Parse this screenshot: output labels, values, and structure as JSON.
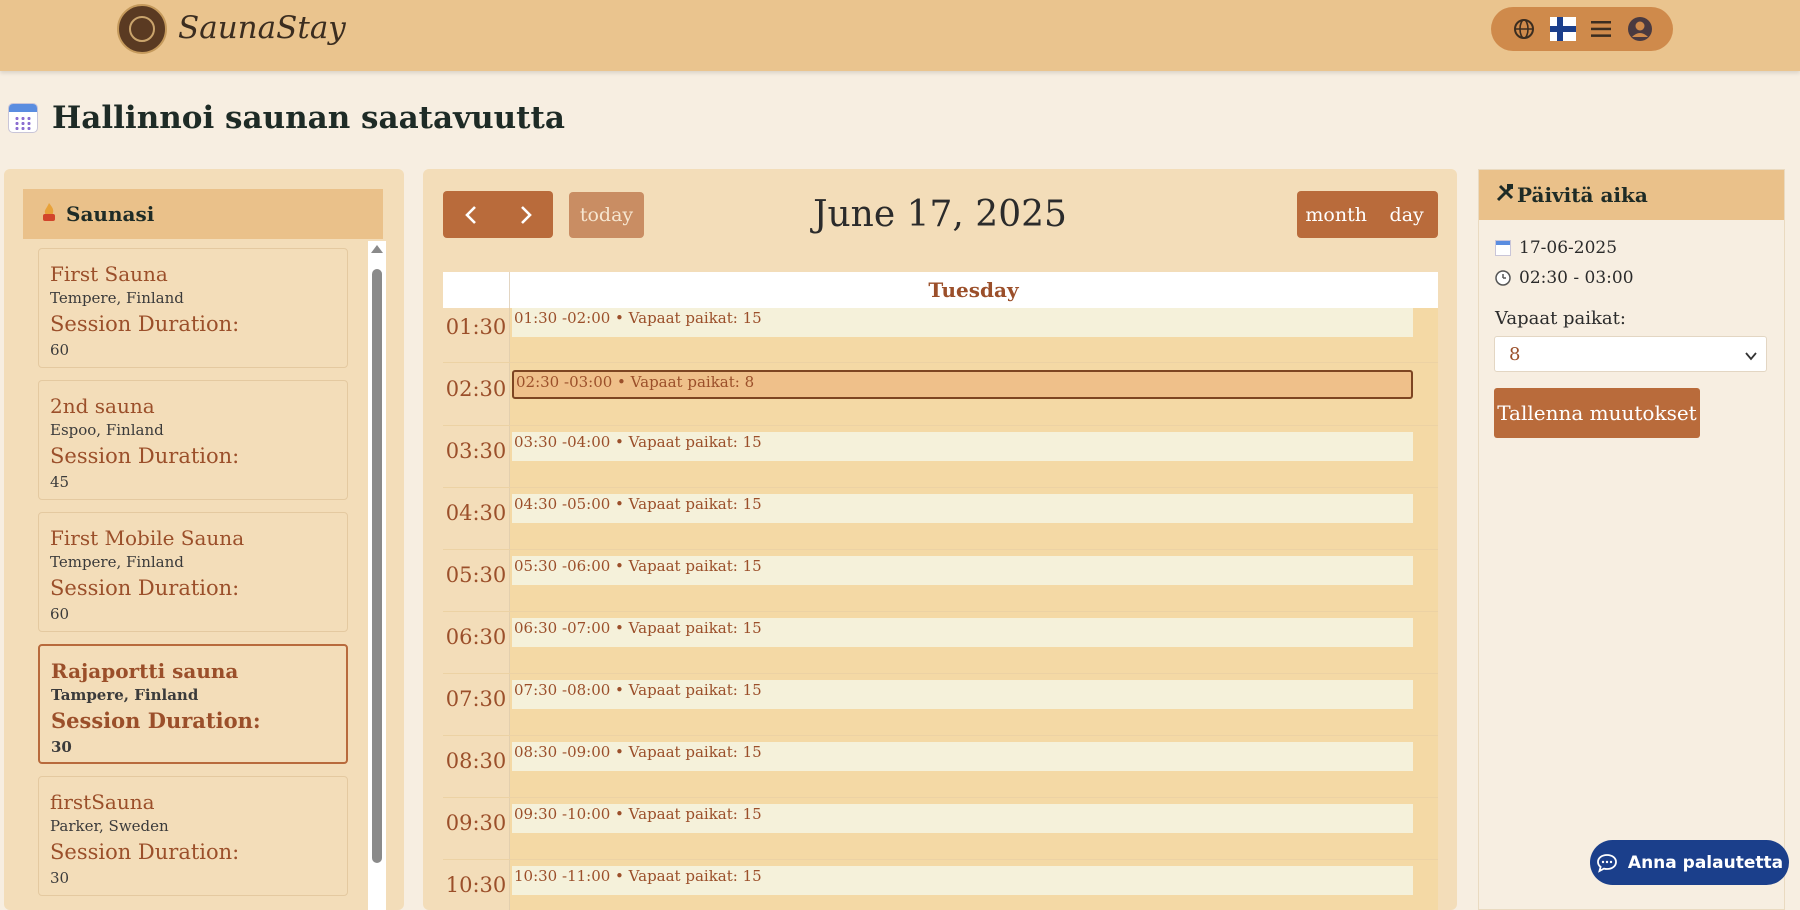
{
  "header": {
    "brand": "SaunaStay",
    "icons": [
      "globe-icon",
      "finland-flag-icon",
      "menu-icon",
      "user-account-icon"
    ]
  },
  "page": {
    "title": "Hallinnoi saunan saatavuutta"
  },
  "saunas": {
    "heading": "Saunasi",
    "items": [
      {
        "name": "First Sauna",
        "location": "Tempere, Finland",
        "duration_label": "Session Duration:",
        "duration": "60"
      },
      {
        "name": "2nd sauna",
        "location": "Espoo, Finland",
        "duration_label": "Session Duration:",
        "duration": "45"
      },
      {
        "name": "First Mobile Sauna",
        "location": "Tempere, Finland",
        "duration_label": "Session Duration:",
        "duration": "60"
      },
      {
        "name": "Rajaportti sauna",
        "location": "Tampere, Finland",
        "duration_label": "Session Duration:",
        "duration": "30",
        "selected": true
      },
      {
        "name": "firstSauna",
        "location": "Parker, Sweden",
        "duration_label": "Session Duration:",
        "duration": "30"
      }
    ]
  },
  "calendar": {
    "today_label": "today",
    "title": "June 17, 2025",
    "views": [
      "month",
      "day"
    ],
    "day_header": "Tuesday",
    "slots": [
      {
        "time": "01:30",
        "event": "01:30 -02:00 • Vapaat paikat: 15"
      },
      {
        "time": "02:30",
        "event": "02:30 -03:00 • Vapaat paikat: 8",
        "selected": true
      },
      {
        "time": "03:30",
        "event": "03:30 -04:00 • Vapaat paikat: 15"
      },
      {
        "time": "04:30",
        "event": "04:30 -05:00 • Vapaat paikat: 15"
      },
      {
        "time": "05:30",
        "event": "05:30 -06:00 • Vapaat paikat: 15"
      },
      {
        "time": "06:30",
        "event": "06:30 -07:00 • Vapaat paikat: 15"
      },
      {
        "time": "07:30",
        "event": "07:30 -08:00 • Vapaat paikat: 15"
      },
      {
        "time": "08:30",
        "event": "08:30 -09:00 • Vapaat paikat: 15"
      },
      {
        "time": "09:30",
        "event": "09:30 -10:00 • Vapaat paikat: 15"
      },
      {
        "time": "10:30",
        "event": "10:30 -11:00 • Vapaat paikat: 15"
      }
    ]
  },
  "update": {
    "heading": "Päivitä aika",
    "date": "17-06-2025",
    "time": "02:30 - 03:00",
    "spots_label": "Vapaat paikat:",
    "spots_value": "8",
    "save_label": "Tallenna muutokset"
  },
  "feedback": {
    "label": "Anna palautetta"
  },
  "colors": {
    "accent": "#b96b3b",
    "header": "#eac48e",
    "event_bg": "#f5f1da",
    "feedback": "#1b3f8b"
  }
}
